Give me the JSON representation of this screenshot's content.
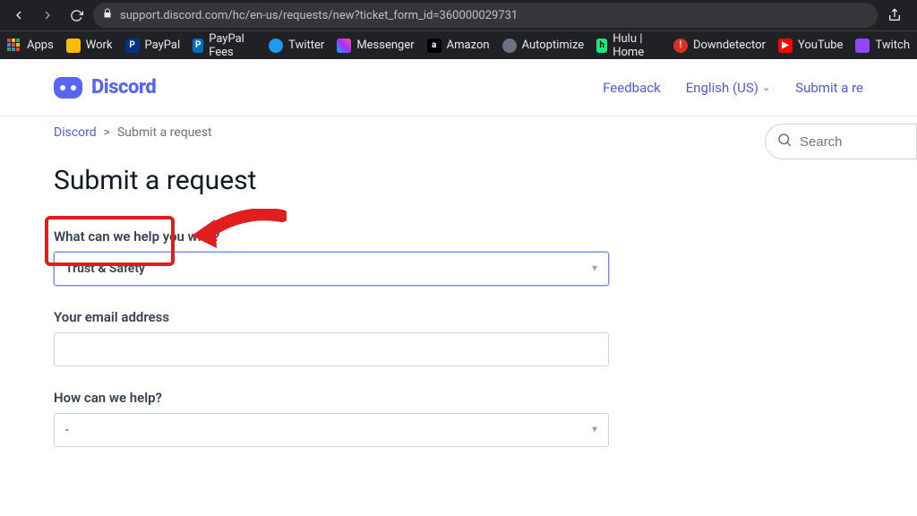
{
  "browser": {
    "url": "support.discord.com/hc/en-us/requests/new?ticket_form_id=360000029731"
  },
  "bookmarks": {
    "apps": "Apps",
    "work": "Work",
    "paypal": "PayPal",
    "paypal_fees": "PayPal Fees",
    "twitter": "Twitter",
    "messenger": "Messenger",
    "amazon": "Amazon",
    "autoptimize": "Autoptimize",
    "hulu": "Hulu | Home",
    "downdetector": "Downdetector",
    "youtube": "YouTube",
    "twitch": "Twitch"
  },
  "header": {
    "brand": "Discord",
    "feedback": "Feedback",
    "language": "English (US)",
    "submit": "Submit a re"
  },
  "breadcrumbs": {
    "root": "Discord",
    "sep": ">",
    "current": "Submit a request"
  },
  "search": {
    "placeholder": "Search"
  },
  "page": {
    "title": "Submit a request"
  },
  "form": {
    "q_help_with": "What can we help you with?",
    "help_with_value": "Trust & Safety",
    "q_email": "Your email address",
    "email_value": "",
    "q_how_help": "How can we help?",
    "how_help_value": "-"
  }
}
